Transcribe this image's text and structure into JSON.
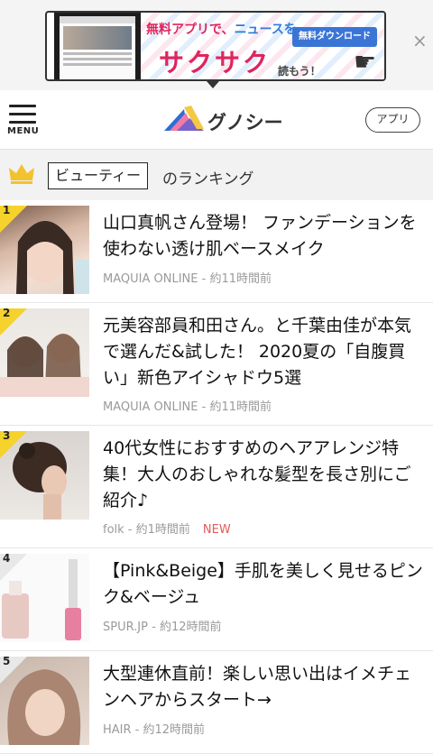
{
  "ad": {
    "headline_pink": "無料アプリで、",
    "headline_blue": "ニュースを、",
    "catch": "サクサク",
    "catch_suffix": "読もう！",
    "download_label": "無料ダウンロード",
    "close_label": "×"
  },
  "header": {
    "menu_label": "MENU",
    "logo_text": "グノシー",
    "app_button": "アプリ"
  },
  "ranking": {
    "category": "ビューティー",
    "suffix": "のランキング"
  },
  "articles": [
    {
      "rank": "1",
      "title": "山口真帆さん登場！ ファンデーションを使わない透け肌ベースメイク",
      "source": "MAQUIA ONLINE",
      "time": "約11時間前",
      "badge": ""
    },
    {
      "rank": "2",
      "title": "元美容部員和田さん。と千葉由佳が本気で選んだ&試した！ 2020夏の「自腹買い」新色アイシャドウ5選",
      "source": "MAQUIA ONLINE",
      "time": "約11時間前",
      "badge": ""
    },
    {
      "rank": "3",
      "title": "40代女性におすすめのヘアアレンジ特集！大人のおしゃれな髪型を長さ別にご紹介♪",
      "source": "folk",
      "time": "約1時間前",
      "badge": "NEW"
    },
    {
      "rank": "4",
      "title": "【Pink&Beige】手肌を美しく見せるピンク&ベージュ",
      "source": "SPUR.JP",
      "time": "約12時間前",
      "badge": ""
    },
    {
      "rank": "5",
      "title": "大型連休直前！楽しい思い出はイメチェンヘアからスタート→",
      "source": "HAIR",
      "time": "約12時間前",
      "badge": ""
    }
  ],
  "colors": {
    "rank_gold": "#f5d22c",
    "rank_grey": "#e8e8e8",
    "new_badge": "#e35a5a"
  }
}
